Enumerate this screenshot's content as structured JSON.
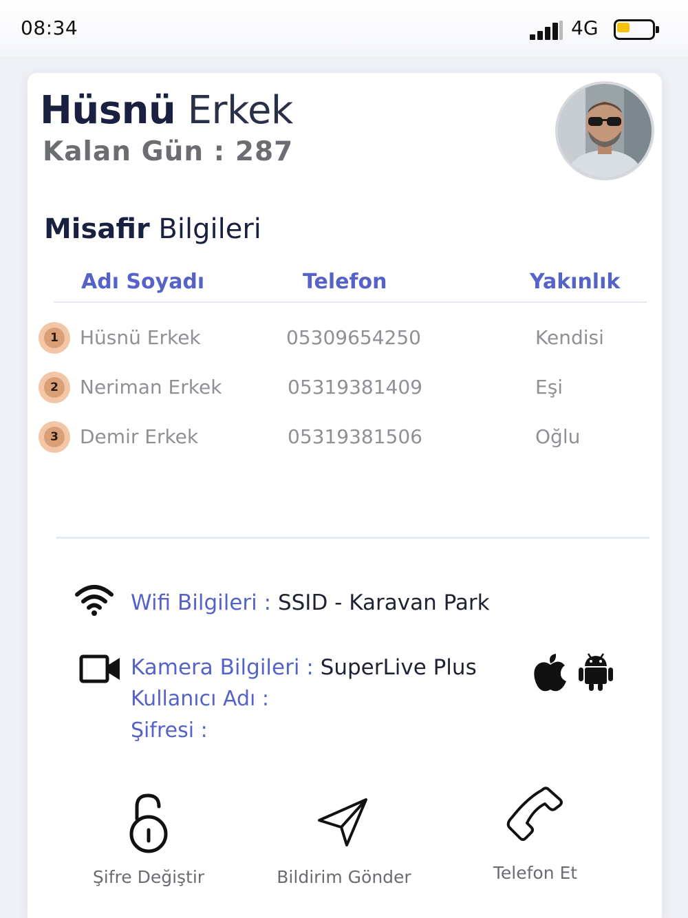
{
  "status_bar": {
    "time": "08:34",
    "network": "4G",
    "battery_level": 0.35,
    "battery_color": "#f5c10a"
  },
  "profile": {
    "first_name": "Hüsnü",
    "last_name": "Erkek",
    "remaining_days": "Kalan Gün : 287"
  },
  "guests": {
    "title_bold": "Misafir",
    "title_rest": "Bilgileri",
    "headers": {
      "name": "Adı Soyadı",
      "phone": "Telefon",
      "relation": "Yakınlık"
    },
    "rows": [
      {
        "index": "1",
        "name": "Hüsnü Erkek",
        "phone": "05309654250",
        "relation": "Kendisi"
      },
      {
        "index": "2",
        "name": "Neriman Erkek",
        "phone": "05319381409",
        "relation": "Eşi"
      },
      {
        "index": "3",
        "name": "Demir Erkek",
        "phone": "05319381506",
        "relation": "Oğlu"
      }
    ]
  },
  "wifi": {
    "label": "Wifi Bilgileri :",
    "value": "SSID - Karavan Park"
  },
  "camera": {
    "label": "Kamera Bilgileri :",
    "value": "SuperLive Plus",
    "username_label": "Kullanıcı Adı :",
    "password_label": "Şifresi :"
  },
  "actions": {
    "change_password": "Şifre Değiştir",
    "send_notification": "Bildirim Gönder",
    "call": "Telefon Et"
  },
  "colors": {
    "accent": "#5563c9",
    "badge": "#f2c6a6"
  }
}
